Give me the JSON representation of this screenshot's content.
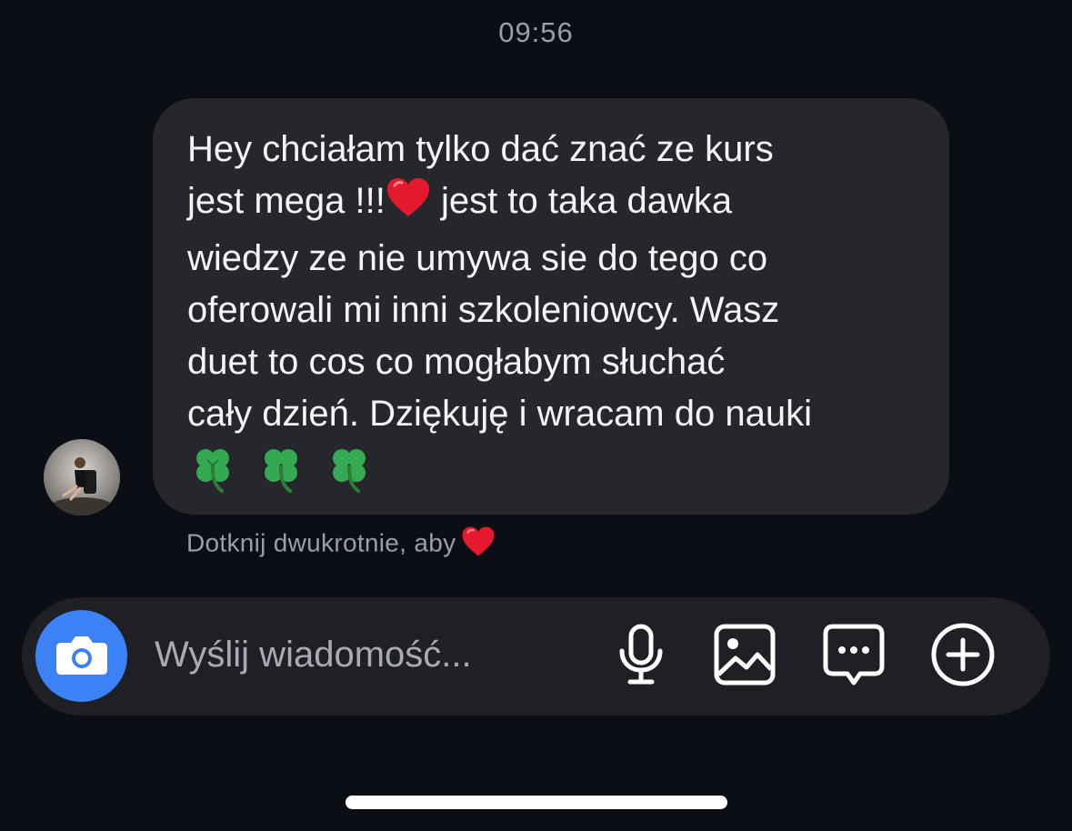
{
  "header": {
    "time": "09:56"
  },
  "message": {
    "lines": [
      "Hey chciałam tylko dać znać ze kurs",
      "jest mega !!!",
      "jest to taka dawka",
      "wiedzy ze nie umywa sie do tego co",
      "oferowali mi inni szkoleniowcy. Wasz",
      "duet to cos co mogłabym słuchać",
      "cały dzień. Dziękuję i wracam do nauki"
    ],
    "emoji_inline": "heart",
    "emoji_trailing": [
      "four-leaf-clover",
      "four-leaf-clover",
      "four-leaf-clover"
    ]
  },
  "hint": {
    "text": "Dotknij dwukrotnie, aby"
  },
  "composer": {
    "placeholder": "Wyślij wiadomość..."
  },
  "colors": {
    "background": "#0b0e14",
    "bubble": "#25272d",
    "composer": "#1e2026",
    "accent": "#3b82f6",
    "heart": "#e5192e",
    "clover": "#34a853"
  }
}
